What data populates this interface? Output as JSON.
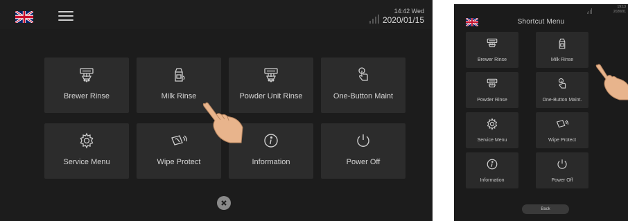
{
  "left_screen": {
    "status": {
      "time": "14:42 Wed",
      "date": "2020/01/15",
      "flag_icon": "uk-flag-icon",
      "menu_icon": "hamburger-menu-icon",
      "signal_icon": "signal-strength-icon"
    },
    "tiles": [
      {
        "label": "Brewer Rinse",
        "icon": "brewer-icon"
      },
      {
        "label": "Milk Rinse",
        "icon": "milk-carton-icon"
      },
      {
        "label": "Powder Unit Rinse",
        "icon": "powder-unit-icon"
      },
      {
        "label": "One-Button Maint",
        "icon": "touch-hand-icon"
      },
      {
        "label": "Service Menu",
        "icon": "gear-icon"
      },
      {
        "label": "Wipe Protect",
        "icon": "wipe-hand-icon"
      },
      {
        "label": "Information",
        "icon": "info-icon"
      },
      {
        "label": "Power Off",
        "icon": "power-icon"
      }
    ],
    "close_icon": "close-icon"
  },
  "right_screen": {
    "status": {
      "title": "Shortcut Menu",
      "time": "19:13",
      "date": "2020/01",
      "flag_icon": "uk-flag-icon"
    },
    "tiles": [
      {
        "label": "Brewer Rinse",
        "icon": "brewer-icon"
      },
      {
        "label": "Milk Rinse",
        "icon": "milk-carton-icon"
      },
      {
        "label": "Powder Rinse",
        "icon": "powder-unit-icon"
      },
      {
        "label": "One-Button Maint.",
        "icon": "touch-hand-icon"
      },
      {
        "label": "Service Menu",
        "icon": "gear-icon"
      },
      {
        "label": "Wipe Protect",
        "icon": "wipe-hand-icon"
      },
      {
        "label": "Information",
        "icon": "info-icon"
      },
      {
        "label": "Power Off",
        "icon": "power-icon"
      }
    ],
    "back_label": "Back"
  },
  "colors": {
    "screen_bg": "#1c1c1c",
    "tile_bg": "#2c2c2c",
    "text": "#d4d4d4",
    "close_button": "#8a8a8a",
    "hand_skin": "#e8b48c"
  }
}
